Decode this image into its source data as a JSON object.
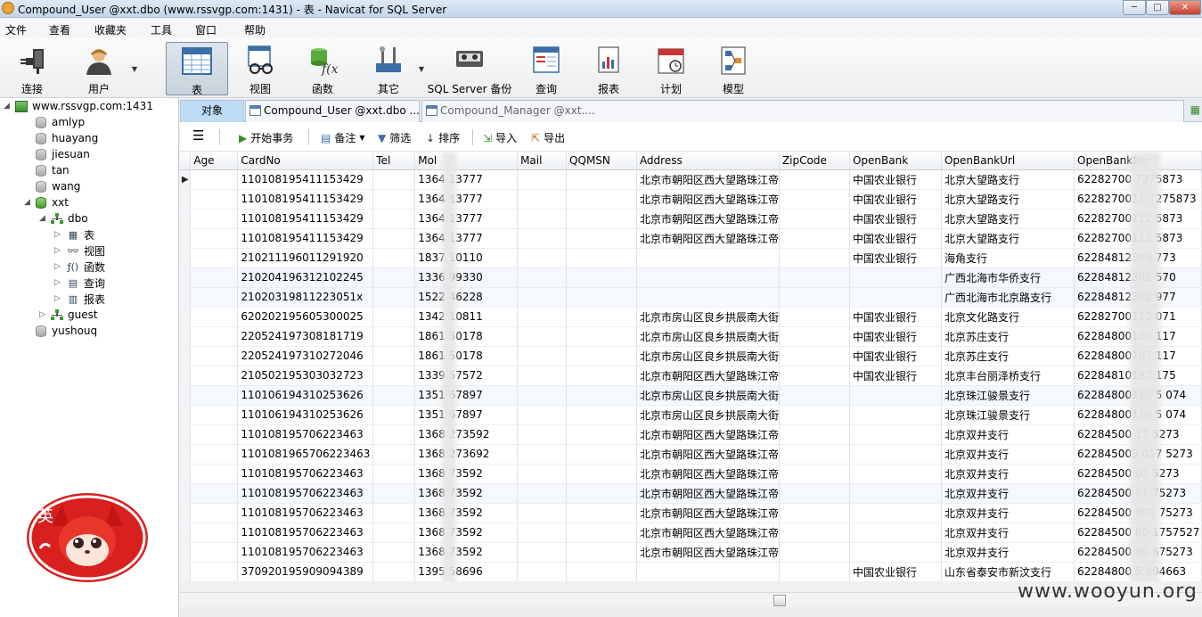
{
  "window": {
    "title": "Compound_User @xxt.dbo (www.rssvgp.com:1431) - 表 - Navicat for SQL Server",
    "controls": [
      "─",
      "□",
      "✕"
    ]
  },
  "menu": [
    "文件",
    "查看",
    "收藏夹",
    "工具",
    "窗口",
    "帮助"
  ],
  "toolbar": [
    {
      "label": "连接",
      "icon": "plug-icon"
    },
    {
      "label": "用户",
      "icon": "user-icon"
    },
    {
      "label": "表",
      "icon": "table-icon"
    },
    {
      "label": "视图",
      "icon": "view-icon"
    },
    {
      "label": "函数",
      "icon": "function-icon"
    },
    {
      "label": "其它",
      "icon": "tools-icon"
    },
    {
      "label": "SQL Server 备份",
      "icon": "backup-icon"
    },
    {
      "label": "查询",
      "icon": "query-icon"
    },
    {
      "label": "报表",
      "icon": "report-icon"
    },
    {
      "label": "计划",
      "icon": "calendar-icon"
    },
    {
      "label": "模型",
      "icon": "model-icon"
    }
  ],
  "sidebar": {
    "server": "www.rssvgp.com:1431",
    "databases": [
      "amlyp",
      "huayang",
      "jiesuan",
      "tan",
      "wang"
    ],
    "open_db": "xxt",
    "schema": "dbo",
    "schema_items": [
      {
        "label": "表",
        "glyph": "▦"
      },
      {
        "label": "视图",
        "glyph": "👓"
      },
      {
        "label": "函数",
        "glyph": "ƒ()"
      },
      {
        "label": "查询",
        "glyph": "▤"
      },
      {
        "label": "报表",
        "glyph": "▥"
      }
    ],
    "guest": "guest",
    "last_db": "yushouq",
    "mascot_text": "英"
  },
  "tabs": [
    {
      "label": "对象"
    },
    {
      "label": "Compound_User @xxt.dbo ..."
    },
    {
      "label": "Compound_Manager @xxt...."
    }
  ],
  "object_toolbar": [
    {
      "label": "开始事务",
      "glyph": "▶"
    },
    {
      "label": "备注",
      "glyph": "▤"
    },
    {
      "label": "筛选",
      "glyph": "▼"
    },
    {
      "label": "排序",
      "glyph": "↓"
    },
    {
      "label": "导入",
      "glyph": "⇲"
    },
    {
      "label": "导出",
      "glyph": "⇱"
    }
  ],
  "grid": {
    "columns": [
      "Age",
      "CardNo",
      "Tel",
      "Mol",
      "Mail",
      "QQMSN",
      "Address",
      "ZipCode",
      "OpenBank",
      "OpenBankUrl",
      "OpenBankNo"
    ],
    "rows": [
      [
        "",
        "110108195411153429",
        "",
        "1364  13777",
        "",
        "",
        "北京市朝阳区西大望路珠江帝",
        "",
        "中国农业银行",
        "北京大望路支行",
        "62282700   7275873"
      ],
      [
        "",
        "110108195411153429",
        "",
        "1364  13777",
        "",
        "",
        "北京市朝阳区西大望路珠江帝",
        "",
        "中国农业银行",
        "北京大望路支行",
        "6228270011  7275873"
      ],
      [
        "",
        "110108195411153429",
        "",
        "1364  13777",
        "",
        "",
        "北京市朝阳区西大望路珠江帝",
        "",
        "中国农业银行",
        "北京大望路支行",
        "62282700112     5873"
      ],
      [
        "",
        "110108195411153429",
        "",
        "1364  13777",
        "",
        "",
        "北京市朝阳区西大望路珠江帝",
        "",
        "中国农业银行",
        "北京大望路支行",
        "62282700112     5873"
      ],
      [
        "",
        "210211196011291920",
        "",
        "1837  10110",
        "",
        "",
        "",
        "",
        "中国农业银行",
        "海角支行",
        "62284812383     773"
      ],
      [
        "",
        "210204196312102245",
        "",
        "1336  99330",
        "",
        "",
        "",
        "",
        "",
        "广西北海市华侨支行",
        "62284812382     570"
      ],
      [
        "",
        "21020319811223051x",
        "",
        "1522  46228",
        "",
        "",
        "",
        "",
        "",
        "广西北海市北京路支行",
        "62284812382     977"
      ],
      [
        "",
        "620202195605300025",
        "",
        "1342  10811",
        "",
        "",
        "北京市房山区良乡拱辰南大街",
        "",
        "中国农业银行",
        "北京文化路支行",
        "62282700112     071"
      ],
      [
        "",
        "220524197308181719",
        "",
        "1861  50178",
        "",
        "",
        "北京市房山区良乡拱辰南大街",
        "",
        "中国农业银行",
        "北京苏庄支行",
        "62284800107     117"
      ],
      [
        "",
        "220524197310272046",
        "",
        "1861  50178",
        "",
        "",
        "北京市房山区良乡拱辰南大街",
        "",
        "中国农业银行",
        "北京苏庄支行",
        "62284800107     117"
      ],
      [
        "",
        "210502195303032723",
        "",
        "1339  57572",
        "",
        "",
        "北京市朝阳区西大望路珠江帝",
        "",
        "中国农业银行",
        "北京丰台丽泽桥支行",
        "62284810187     175"
      ],
      [
        "",
        "110106194310253626",
        "",
        "1351  67897",
        "",
        "",
        "北京市房山区良乡拱辰南大街",
        "",
        "",
        "北京珠江骏景支行",
        "62284800110   5  074"
      ],
      [
        "",
        "110106194310253626",
        "",
        "1351  67897",
        "",
        "",
        "北京市房山区良乡拱辰南大街",
        "",
        "",
        "北京珠江骏景支行",
        "62284800110   5  074"
      ],
      [
        "",
        "110108195706223463",
        "",
        "1368  273592",
        "",
        "",
        "北京市朝阳区西大望路珠江帝",
        "",
        "",
        "北京双井支行",
        "62284500   17  5273"
      ],
      [
        "",
        "1101081965706223463",
        "",
        "1368  273692",
        "",
        "",
        "北京市朝阳区西大望路珠江帝",
        "",
        "",
        "北京双井支行",
        "622845003  017  5273"
      ],
      [
        "",
        "110108195706223463",
        "",
        "1368  73592",
        "",
        "",
        "北京市朝阳区西大望路珠江帝",
        "",
        "",
        "北京双井支行",
        "62284500   01   5273"
      ],
      [
        "",
        "110108195706223463",
        "",
        "1368  73592",
        "",
        "",
        "北京市朝阳区西大望路珠江帝",
        "",
        "",
        "北京双井支行",
        "62284500   01   75273"
      ],
      [
        "",
        "110108195706223463",
        "",
        "1368  73592",
        "",
        "",
        "北京市朝阳区西大望路珠江帝",
        "",
        "",
        "北京双井支行",
        "62284500   801  75273"
      ],
      [
        "",
        "110108195706223463",
        "",
        "1368  73592",
        "",
        "",
        "北京市朝阳区西大望路珠江帝",
        "",
        "",
        "北京双井支行",
        "62284500   80   1757527"
      ],
      [
        "",
        "110108195706223463",
        "",
        "1368  73592",
        "",
        "",
        "北京市朝阳区西大望路珠江帝",
        "",
        "",
        "北京双井支行",
        "62284500   80   675273"
      ],
      [
        "",
        "370920195909094389",
        "",
        "1395  58696",
        "",
        "",
        "",
        "",
        "中国农业银行",
        "山东省泰安市新汶支行",
        "62284800   5   004663"
      ]
    ]
  },
  "watermark": "www.wooyun.org"
}
